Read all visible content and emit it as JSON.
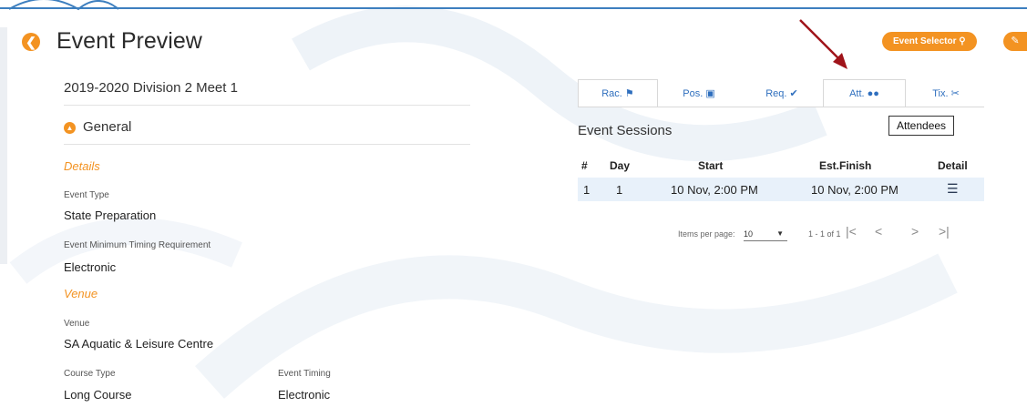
{
  "header": {
    "title": "Event Preview",
    "event_selector_label": "Event Selector",
    "back_icon": "arrow-left-icon",
    "tag_icon": "tag-icon",
    "accent": "#f39322"
  },
  "left": {
    "meet_name": "2019-2020 Division 2 Meet 1",
    "general_label": "General",
    "details_heading": "Details",
    "event_type_label": "Event Type",
    "event_type_value": "State Preparation",
    "min_timing_label": "Event Minimum Timing Requirement",
    "min_timing_value": "Electronic",
    "venue_heading": "Venue",
    "venue_label": "Venue",
    "venue_value": "SA Aquatic & Leisure Centre",
    "course_type_label": "Course Type",
    "course_type_value": "Long Course",
    "event_timing_label": "Event Timing",
    "event_timing_value": "Electronic"
  },
  "tabs": [
    {
      "label": "Rac.",
      "icon": "flag-icon"
    },
    {
      "label": "Pos.",
      "icon": "id-badge-icon"
    },
    {
      "label": "Req.",
      "icon": "check-circle-icon"
    },
    {
      "label": "Att.",
      "icon": "users-icon"
    },
    {
      "label": "Tix.",
      "icon": "ticket-icon"
    }
  ],
  "tooltip": "Attendees",
  "sessions": {
    "heading": "Event Sessions",
    "columns": [
      "#",
      "Day",
      "Start",
      "Est.Finish",
      "Detail"
    ],
    "rows": [
      {
        "num": "1",
        "day": "1",
        "start": "10 Nov, 2:00 PM",
        "finish": "10 Nov, 2:00 PM",
        "detail_icon": "list-icon"
      }
    ],
    "items_per_page_label": "Items per page:",
    "items_per_page_value": "10",
    "range": "1 - 1 of 1"
  }
}
